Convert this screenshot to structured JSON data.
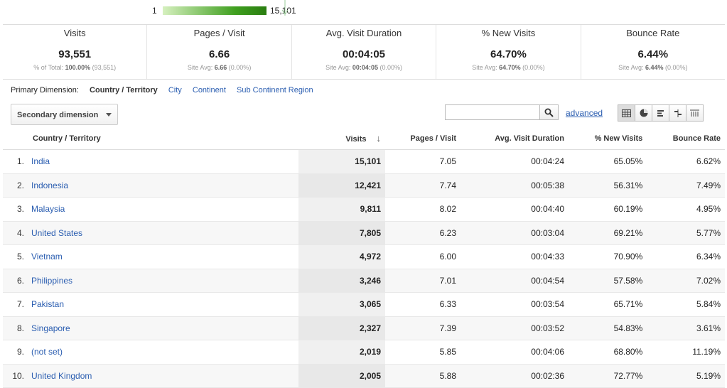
{
  "map_legend": {
    "min": "1",
    "max": "15,101"
  },
  "summary": [
    {
      "title": "Visits",
      "value": "93,551",
      "sub_prefix": "% of Total: ",
      "sub_bold": "100.00%",
      "sub_suffix": " (93,551)"
    },
    {
      "title": "Pages / Visit",
      "value": "6.66",
      "sub_prefix": "Site Avg: ",
      "sub_bold": "6.66",
      "sub_suffix": " (0.00%)"
    },
    {
      "title": "Avg. Visit Duration",
      "value": "00:04:05",
      "sub_prefix": "Site Avg: ",
      "sub_bold": "00:04:05",
      "sub_suffix": " (0.00%)"
    },
    {
      "title": "% New Visits",
      "value": "64.70%",
      "sub_prefix": "Site Avg: ",
      "sub_bold": "64.70%",
      "sub_suffix": " (0.00%)"
    },
    {
      "title": "Bounce Rate",
      "value": "6.44%",
      "sub_prefix": "Site Avg: ",
      "sub_bold": "6.44%",
      "sub_suffix": " (0.00%)"
    }
  ],
  "dimensions": {
    "label": "Primary Dimension:",
    "current": "Country / Territory",
    "options": [
      "City",
      "Continent",
      "Sub Continent Region"
    ]
  },
  "secondary_dimension": "Secondary dimension",
  "search": {
    "value": "",
    "advanced": "advanced"
  },
  "views": [
    "table-view-icon",
    "pie-view-icon",
    "bar-view-icon",
    "comparison-view-icon",
    "pivot-view-icon"
  ],
  "table": {
    "headers": {
      "country": "Country / Territory",
      "visits": "Visits",
      "pages": "Pages / Visit",
      "duration": "Avg. Visit Duration",
      "new": "% New Visits",
      "bounce": "Bounce Rate"
    },
    "rows": [
      {
        "n": "1.",
        "country": "India",
        "visits": "15,101",
        "pages": "7.05",
        "duration": "00:04:24",
        "new": "65.05%",
        "bounce": "6.62%"
      },
      {
        "n": "2.",
        "country": "Indonesia",
        "visits": "12,421",
        "pages": "7.74",
        "duration": "00:05:38",
        "new": "56.31%",
        "bounce": "7.49%"
      },
      {
        "n": "3.",
        "country": "Malaysia",
        "visits": "9,811",
        "pages": "8.02",
        "duration": "00:04:40",
        "new": "60.19%",
        "bounce": "4.95%"
      },
      {
        "n": "4.",
        "country": "United States",
        "visits": "7,805",
        "pages": "6.23",
        "duration": "00:03:04",
        "new": "69.21%",
        "bounce": "5.77%"
      },
      {
        "n": "5.",
        "country": "Vietnam",
        "visits": "4,972",
        "pages": "6.00",
        "duration": "00:04:33",
        "new": "70.90%",
        "bounce": "6.34%"
      },
      {
        "n": "6.",
        "country": "Philippines",
        "visits": "3,246",
        "pages": "7.01",
        "duration": "00:04:54",
        "new": "57.58%",
        "bounce": "7.02%"
      },
      {
        "n": "7.",
        "country": "Pakistan",
        "visits": "3,065",
        "pages": "6.33",
        "duration": "00:03:54",
        "new": "65.71%",
        "bounce": "5.84%"
      },
      {
        "n": "8.",
        "country": "Singapore",
        "visits": "2,327",
        "pages": "7.39",
        "duration": "00:03:52",
        "new": "54.83%",
        "bounce": "3.61%"
      },
      {
        "n": "9.",
        "country": "(not set)",
        "visits": "2,019",
        "pages": "5.85",
        "duration": "00:04:06",
        "new": "68.80%",
        "bounce": "11.19%"
      },
      {
        "n": "10.",
        "country": "United Kingdom",
        "visits": "2,005",
        "pages": "5.88",
        "duration": "00:02:36",
        "new": "72.77%",
        "bounce": "5.19%"
      }
    ]
  }
}
